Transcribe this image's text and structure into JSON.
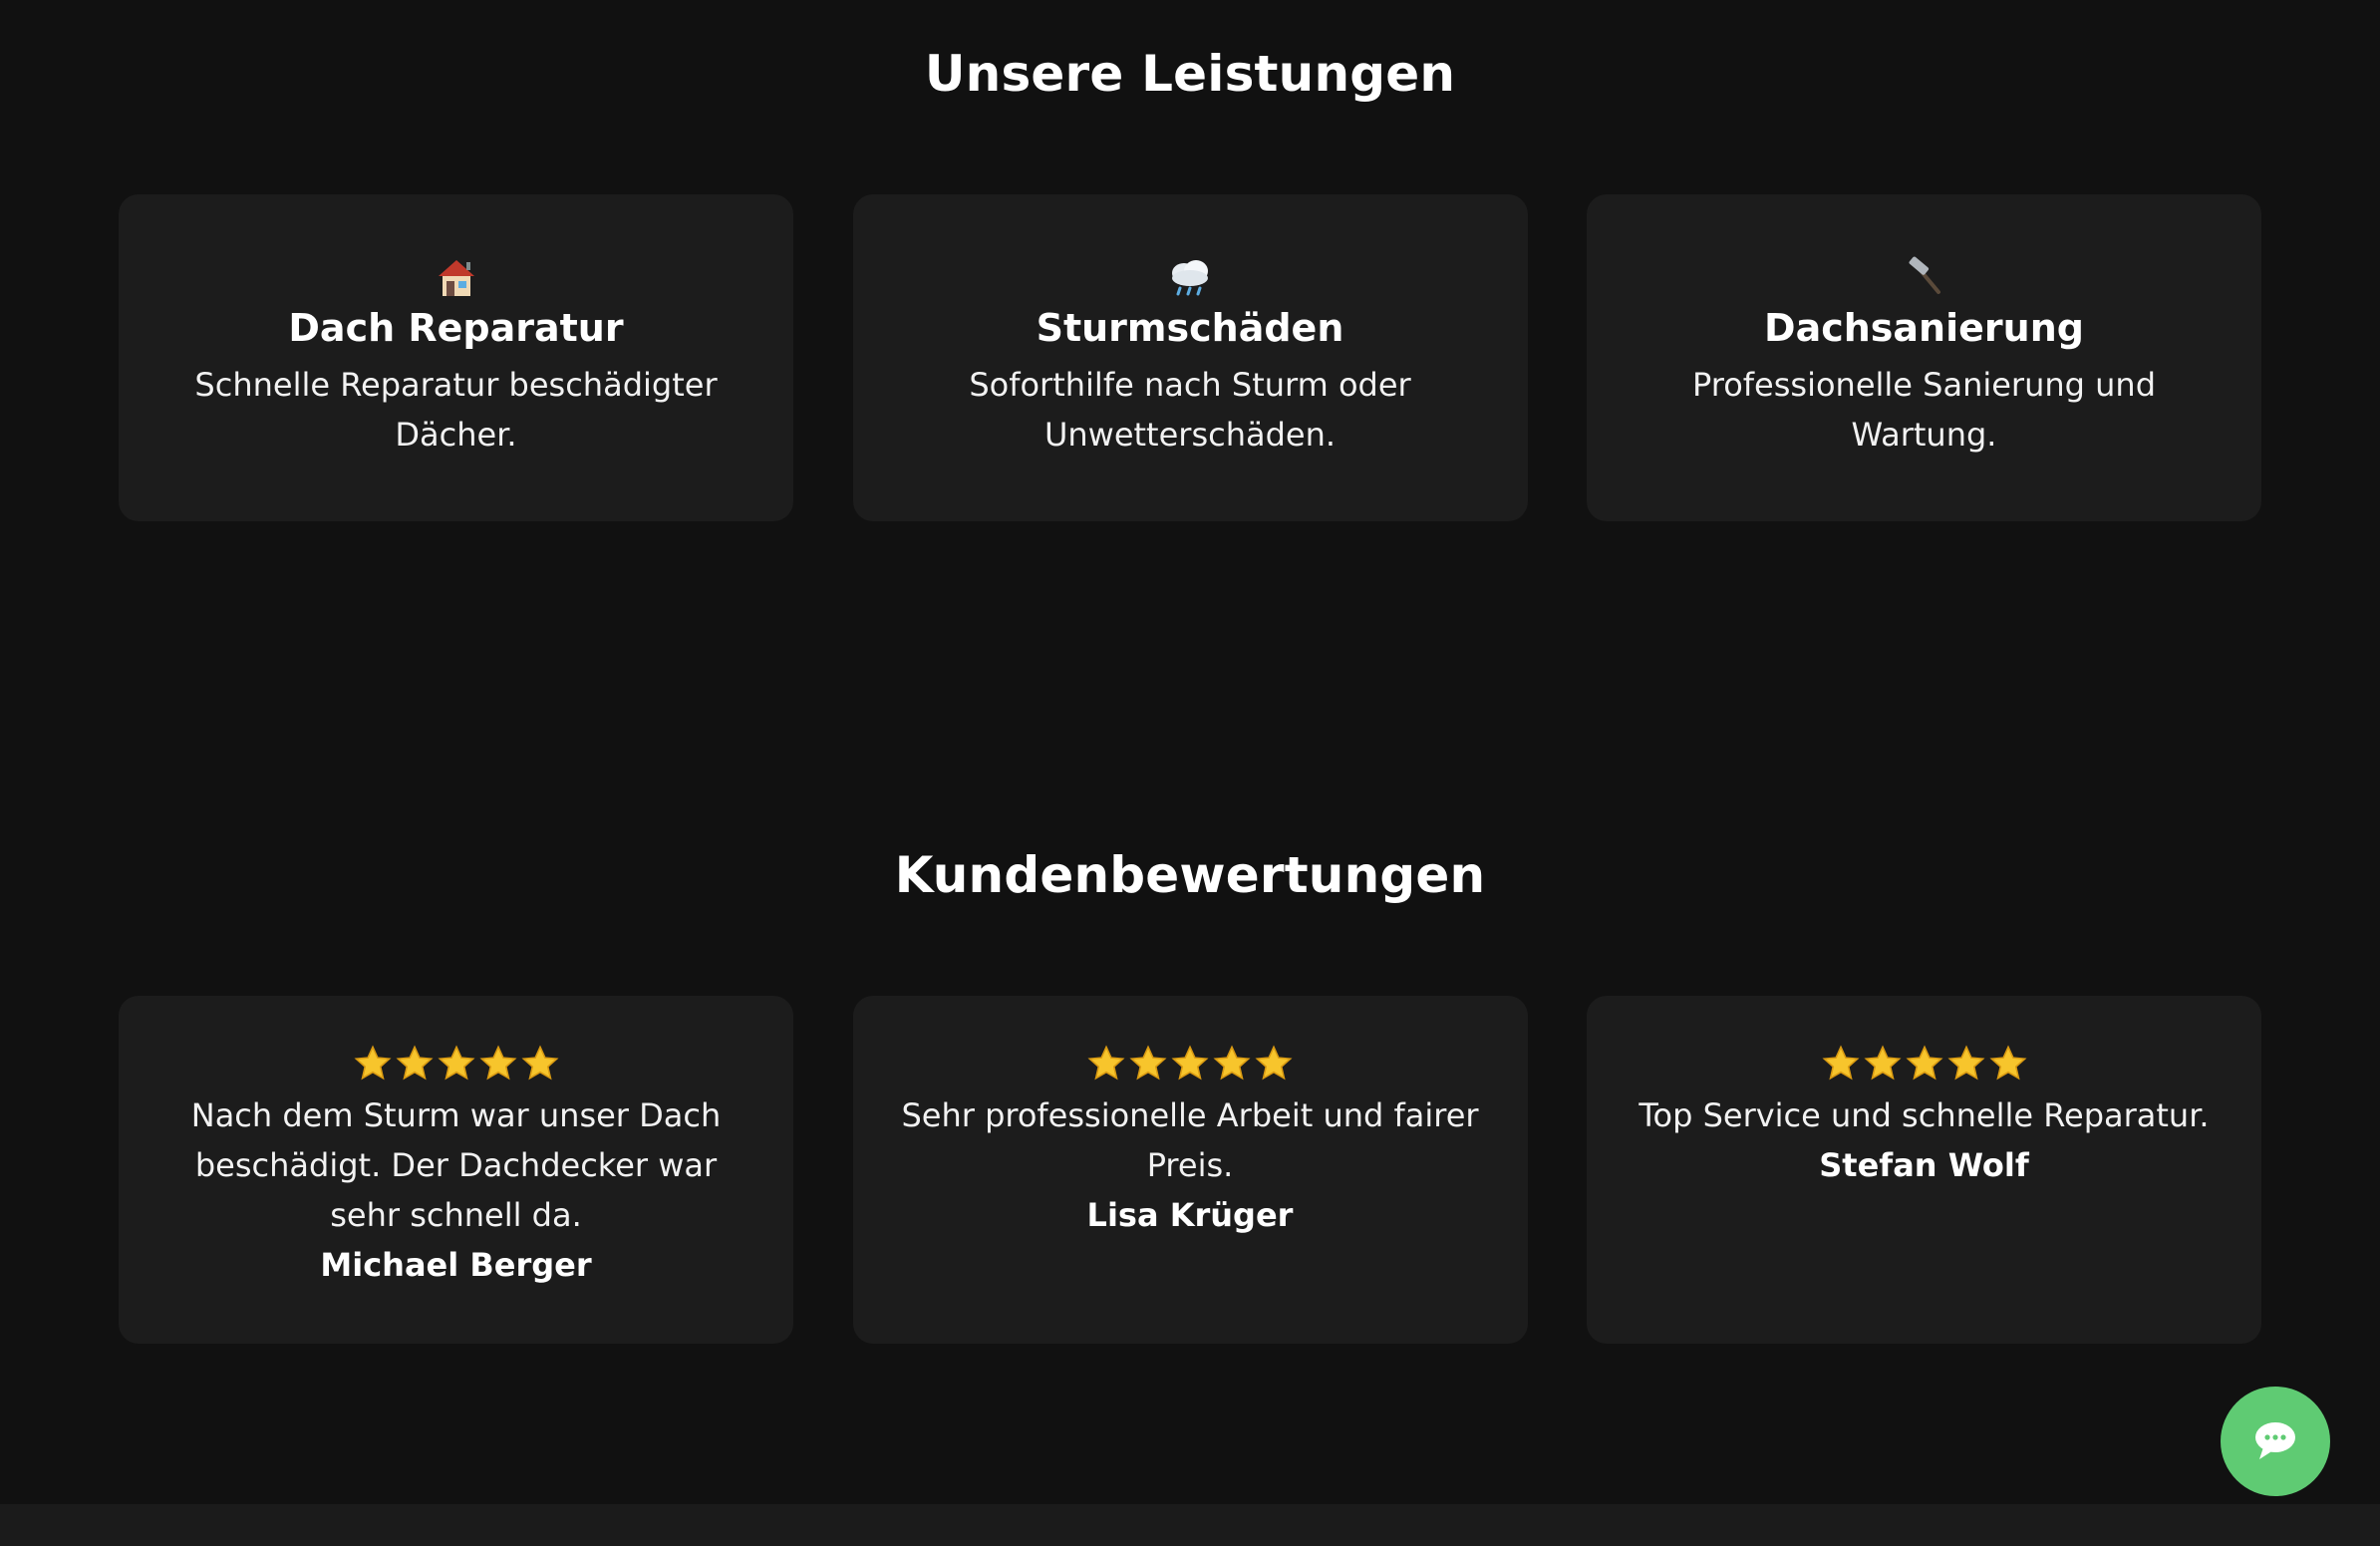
{
  "services": {
    "title": "Unsere Leistungen",
    "items": [
      {
        "icon": "house-icon",
        "name": "Dach Reparatur",
        "description": "Schnelle Reparatur beschädigter Dächer."
      },
      {
        "icon": "rain-cloud-icon",
        "name": "Sturmschäden",
        "description": "Soforthilfe nach Sturm oder Unwetterschäden."
      },
      {
        "icon": "hammer-icon",
        "name": "Dachsanierung",
        "description": "Professionelle Sanierung und Wartung."
      }
    ]
  },
  "reviews": {
    "title": "Kundenbewertungen",
    "items": [
      {
        "rating": 5,
        "text": "Nach dem Sturm war unser Dach beschädigt. Der Dachdecker war sehr schnell da.",
        "author": "Michael Berger"
      },
      {
        "rating": 5,
        "text": "Sehr professionelle Arbeit und fairer Preis.",
        "author": "Lisa Krüger"
      },
      {
        "rating": 5,
        "text": "Top Service und schnelle Reparatur.",
        "author": "Stefan Wolf"
      }
    ]
  },
  "chat": {
    "icon": "chat-bubble-icon"
  },
  "colors": {
    "background": "#111111",
    "card": "#1c1c1c",
    "chat_button": "#5fcb73",
    "star": "#f7c52c"
  }
}
